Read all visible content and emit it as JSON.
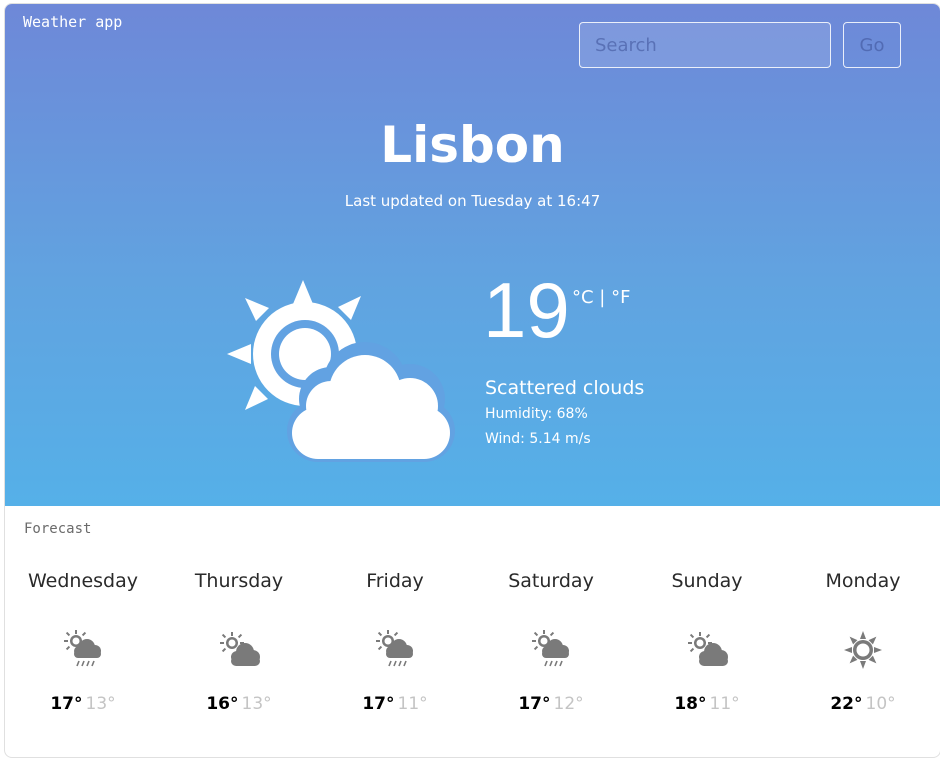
{
  "app": {
    "title": "Weather app"
  },
  "search": {
    "placeholder": "Search",
    "value": "",
    "button_label": "Go"
  },
  "current": {
    "city": "Lisbon",
    "updated": "Last updated on Tuesday at 16:47",
    "temperature": "19",
    "unit_c": "°C",
    "unit_sep": " | ",
    "unit_f": "°F",
    "description": "Scattered clouds",
    "humidity": "Humidity: 68%",
    "wind": "Wind: 5.14 m/s",
    "icon": "partly-cloudy-icon"
  },
  "forecast": {
    "label": "Forecast",
    "days": [
      {
        "name": "Wednesday",
        "icon": "sun-cloud-rain-icon",
        "max": "17°",
        "min": "13°"
      },
      {
        "name": "Thursday",
        "icon": "sun-cloud-icon",
        "max": "16°",
        "min": "13°"
      },
      {
        "name": "Friday",
        "icon": "sun-cloud-rain-icon",
        "max": "17°",
        "min": "11°"
      },
      {
        "name": "Saturday",
        "icon": "sun-cloud-rain-icon",
        "max": "17°",
        "min": "12°"
      },
      {
        "name": "Sunday",
        "icon": "sun-cloud-icon",
        "max": "18°",
        "min": "11°"
      },
      {
        "name": "Monday",
        "icon": "sun-icon",
        "max": "22°",
        "min": "10°"
      }
    ]
  },
  "colors": {
    "gradient_top": "#6e88d8",
    "gradient_bottom": "#55b0e8",
    "icon_gray": "#7a7a7a",
    "min_temp": "#c4c4c4"
  }
}
